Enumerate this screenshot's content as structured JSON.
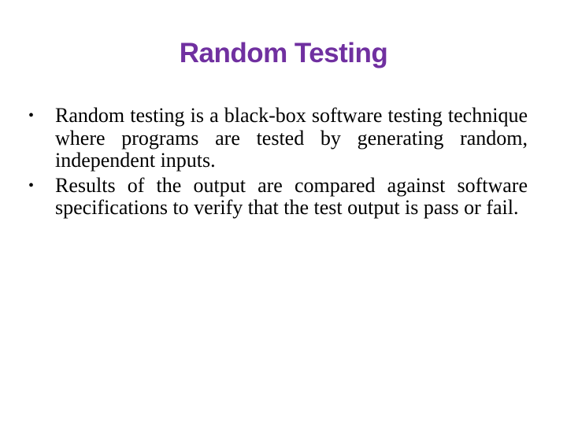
{
  "slide": {
    "title": "Random Testing",
    "title_color": "#7030A0",
    "bullet_icon": "•",
    "bullets": [
      {
        "text": "Random testing is a black-box software testing technique where programs are tested by generating random, independent inputs."
      },
      {
        "text": "Results of the output are compared against software specifications to verify that the test output is pass or fail."
      }
    ]
  }
}
